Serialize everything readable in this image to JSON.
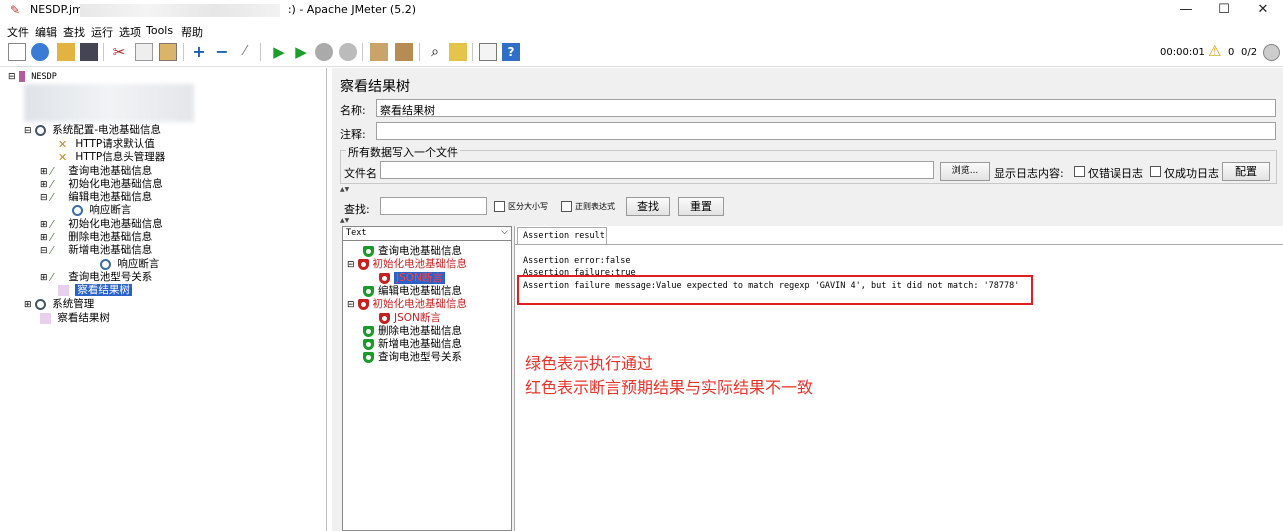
{
  "window": {
    "title_prefix": "NESDP.jm",
    "title_suffix": ":) - Apache JMeter (5.2)",
    "minimize": "—",
    "maximize": "☐",
    "close": "✕"
  },
  "menu": [
    "文件",
    "编辑",
    "查找",
    "运行",
    "选项",
    "Tools",
    "帮助"
  ],
  "toolbar": {
    "timer": "00:00:01",
    "warnings": "0",
    "threads": "0/2"
  },
  "tree": {
    "root": "NESDP",
    "items": [
      "系统配置-电池基础信息",
      "HTTP请求默认值",
      "HTTP信息头管理器",
      "查询电池基础信息",
      "初始化电池基础信息",
      "编辑电池基础信息",
      "响应断言",
      "初始化电池基础信息",
      "删除电池基础信息",
      "新增电池基础信息",
      "响应断言",
      "查询电池型号关系",
      "察看结果树",
      "系统管理",
      "察看结果树"
    ]
  },
  "panel": {
    "title": "察看结果树",
    "name_label": "名称:",
    "name_value": "察看结果树",
    "comment_label": "注释:",
    "comment_value": "",
    "file_section": "所有数据写入一个文件",
    "file_label": "文件名",
    "browse": "浏览...",
    "log_label": "显示日志内容:",
    "errors_only": "仅错误日志",
    "success_only": "仅成功日志",
    "configure": "配置",
    "search_label": "查找:",
    "case_sensitive": "区分大小写",
    "regex": "正则表达式",
    "find": "查找",
    "reset": "重置",
    "renderer": "Text"
  },
  "results": {
    "items": [
      {
        "label": "查询电池基础信息",
        "status": "ok"
      },
      {
        "label": "初始化电池基础信息",
        "status": "bad"
      },
      {
        "label": "JSON断言",
        "status": "bad"
      },
      {
        "label": "编辑电池基础信息",
        "status": "ok"
      },
      {
        "label": "初始化电池基础信息",
        "status": "bad"
      },
      {
        "label": "JSON断言",
        "status": "bad"
      },
      {
        "label": "删除电池基础信息",
        "status": "ok"
      },
      {
        "label": "新增电池基础信息",
        "status": "ok"
      },
      {
        "label": "查询电池型号关系",
        "status": "ok"
      }
    ],
    "tab": "Assertion result",
    "line1": "Assertion error:false",
    "line2": "Assertion failure:true",
    "line3": "Assertion failure message:Value expected to match regexp 'GAVIN 4', but it did not match: '78778'",
    "note1": "绿色表示执行通过",
    "note2": "红色表示断言预期结果与实际结果不一致"
  },
  "colors": {
    "pass": "#1a9a2a",
    "fail": "#c62020",
    "highlight_box": "#e02020",
    "annotation": "#e8332a"
  }
}
